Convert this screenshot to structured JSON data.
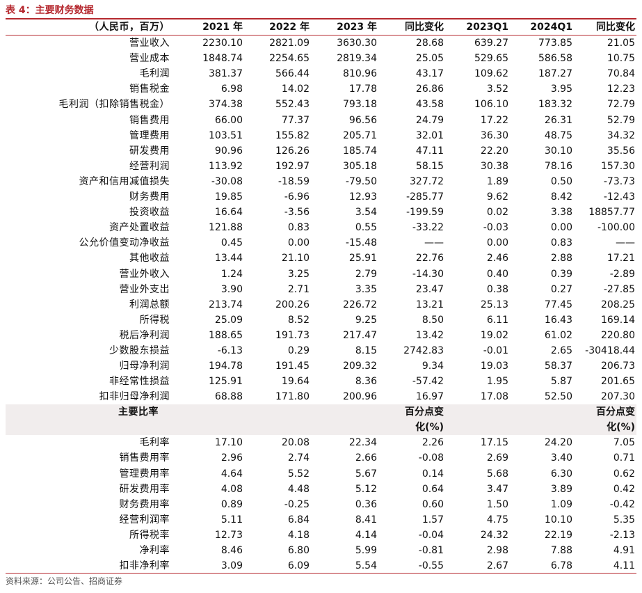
{
  "caption": "表 4：主要财务数据",
  "header": [
    "（人民币，百万）",
    "2021 年",
    "2022 年",
    "2023 年",
    "同比变化",
    "2023Q1",
    "2024Q1",
    "同比变化"
  ],
  "rows": [
    [
      "营业收入",
      "2230.10",
      "2821.09",
      "3630.30",
      "28.68",
      "639.27",
      "773.85",
      "21.05"
    ],
    [
      "营业成本",
      "1848.74",
      "2254.65",
      "2819.34",
      "25.05",
      "529.65",
      "586.58",
      "10.75"
    ],
    [
      "毛利润",
      "381.37",
      "566.44",
      "810.96",
      "43.17",
      "109.62",
      "187.27",
      "70.84"
    ],
    [
      "销售税金",
      "6.98",
      "14.02",
      "17.78",
      "26.86",
      "3.52",
      "3.95",
      "12.23"
    ],
    [
      "毛利润（扣除销售税金）",
      "374.38",
      "552.43",
      "793.18",
      "43.58",
      "106.10",
      "183.32",
      "72.79"
    ],
    [
      "销售费用",
      "66.00",
      "77.37",
      "96.56",
      "24.79",
      "17.22",
      "26.31",
      "52.79"
    ],
    [
      "管理费用",
      "103.51",
      "155.82",
      "205.71",
      "32.01",
      "36.30",
      "48.75",
      "34.32"
    ],
    [
      "研发费用",
      "90.96",
      "126.26",
      "185.74",
      "47.11",
      "22.20",
      "30.10",
      "35.56"
    ],
    [
      "经营利润",
      "113.92",
      "192.97",
      "305.18",
      "58.15",
      "30.38",
      "78.16",
      "157.30"
    ],
    [
      "资产和信用减值损失",
      "-30.08",
      "-18.59",
      "-79.50",
      "327.72",
      "1.89",
      "0.50",
      "-73.73"
    ],
    [
      "财务费用",
      "19.85",
      "-6.96",
      "12.93",
      "-285.77",
      "9.62",
      "8.42",
      "-12.43"
    ],
    [
      "投资收益",
      "16.64",
      "-3.56",
      "3.54",
      "-199.59",
      "0.02",
      "3.38",
      "18857.77"
    ],
    [
      "资产处置收益",
      "121.88",
      "0.83",
      "0.55",
      "-33.22",
      "-0.03",
      "0.00",
      "-100.00"
    ],
    [
      "公允价值变动净收益",
      "0.45",
      "0.00",
      "-15.48",
      "——",
      "0.00",
      "0.83",
      "——"
    ],
    [
      "其他收益",
      "13.44",
      "21.10",
      "25.91",
      "22.76",
      "2.46",
      "2.88",
      "17.21"
    ],
    [
      "营业外收入",
      "1.24",
      "3.25",
      "2.79",
      "-14.30",
      "0.40",
      "0.39",
      "-2.89"
    ],
    [
      "营业外支出",
      "3.90",
      "2.71",
      "3.35",
      "23.47",
      "0.38",
      "0.27",
      "-27.85"
    ],
    [
      "利润总额",
      "213.74",
      "200.26",
      "226.72",
      "13.21",
      "25.13",
      "77.45",
      "208.25"
    ],
    [
      "所得税",
      "25.09",
      "8.52",
      "9.25",
      "8.50",
      "6.11",
      "16.43",
      "169.14"
    ],
    [
      "税后净利润",
      "188.65",
      "191.73",
      "217.47",
      "13.42",
      "19.02",
      "61.02",
      "220.80"
    ],
    [
      "少数股东损益",
      "-6.13",
      "0.29",
      "8.15",
      "2742.83",
      "-0.01",
      "2.65",
      "-30418.44"
    ],
    [
      "归母净利润",
      "194.78",
      "191.45",
      "209.32",
      "9.34",
      "19.03",
      "58.37",
      "206.73"
    ],
    [
      "非经常性损益",
      "125.91",
      "19.64",
      "8.36",
      "-57.42",
      "1.95",
      "5.87",
      "201.65"
    ],
    [
      "扣非归母净利润",
      "68.88",
      "171.80",
      "200.96",
      "16.97",
      "17.08",
      "52.50",
      "207.30"
    ]
  ],
  "ratio_header": {
    "label": "主要比率",
    "change_line1": "百分点变",
    "change_line2": "化(%)"
  },
  "ratio_rows": [
    [
      "毛利率",
      "17.10",
      "20.08",
      "22.34",
      "2.26",
      "17.15",
      "24.20",
      "7.05"
    ],
    [
      "销售费用率",
      "2.96",
      "2.74",
      "2.66",
      "-0.08",
      "2.69",
      "3.40",
      "0.71"
    ],
    [
      "管理费用率",
      "4.64",
      "5.52",
      "5.67",
      "0.14",
      "5.68",
      "6.30",
      "0.62"
    ],
    [
      "研发费用率",
      "4.08",
      "4.48",
      "5.12",
      "0.64",
      "3.47",
      "3.89",
      "0.42"
    ],
    [
      "财务费用率",
      "0.89",
      "-0.25",
      "0.36",
      "0.60",
      "1.50",
      "1.09",
      "-0.42"
    ],
    [
      "经营利润率",
      "5.11",
      "6.84",
      "8.41",
      "1.57",
      "4.75",
      "10.10",
      "5.35"
    ],
    [
      "所得税率",
      "12.73",
      "4.18",
      "4.14",
      "-0.04",
      "24.32",
      "22.19",
      "-2.13"
    ],
    [
      "净利率",
      "8.46",
      "6.80",
      "5.99",
      "-0.81",
      "2.98",
      "7.88",
      "4.91"
    ],
    [
      "扣非净利率",
      "3.09",
      "6.09",
      "5.54",
      "-0.55",
      "2.67",
      "6.78",
      "4.11"
    ]
  ],
  "source": "资料来源：公司公告、招商证券"
}
